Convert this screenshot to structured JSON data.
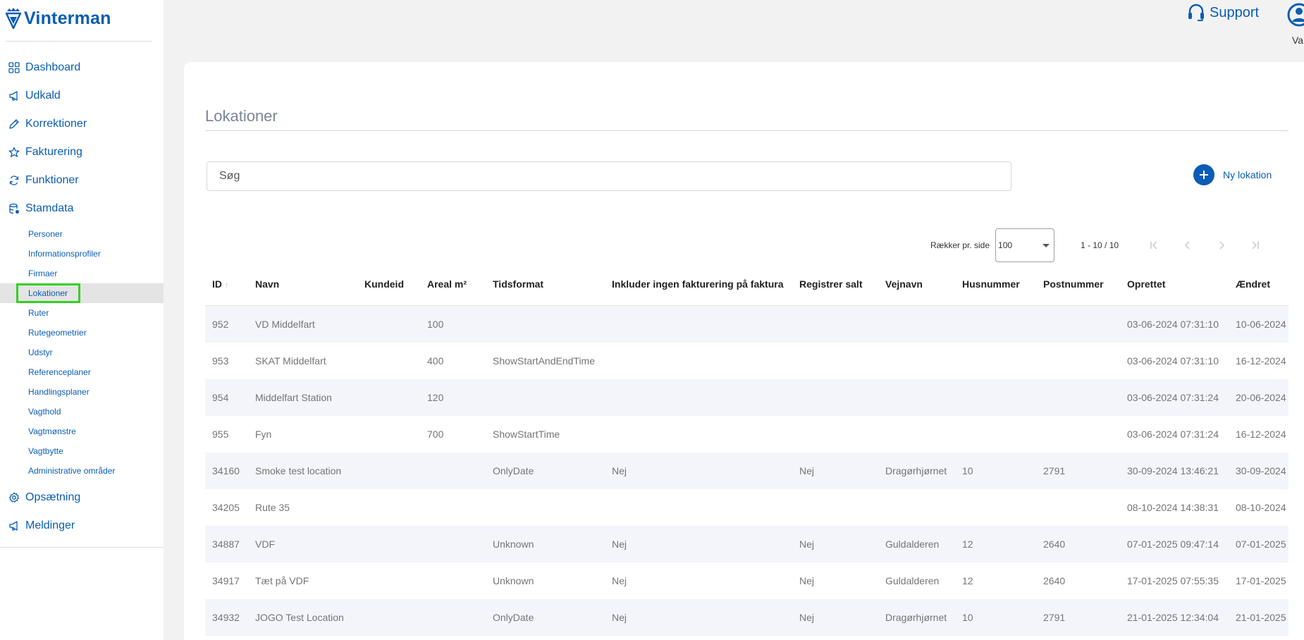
{
  "app": {
    "name": "Vinterman"
  },
  "sidebar": {
    "items": [
      {
        "label": "Dashboard",
        "icon": "grid-icon"
      },
      {
        "label": "Udkald",
        "icon": "megaphone-icon"
      },
      {
        "label": "Korrektioner",
        "icon": "pencil-icon"
      },
      {
        "label": "Fakturering",
        "icon": "star-icon"
      },
      {
        "label": "Funktioner",
        "icon": "refresh-icon"
      },
      {
        "label": "Stamdata",
        "icon": "database-icon"
      }
    ],
    "stamdata_sub": [
      "Personer",
      "Informationsprofiler",
      "Firmaer",
      "Lokationer",
      "Ruter",
      "Rutegeometrier",
      "Udstyr",
      "Referenceplaner",
      "Handlingsplaner",
      "Vagthold",
      "Vagtmønstre",
      "Vagtbytte",
      "Administrative områder"
    ],
    "active_sub": "Lokationer",
    "bottom_items": [
      {
        "label": "Opsætning",
        "icon": "gear-icon"
      },
      {
        "label": "Meldinger",
        "icon": "megaphone-icon"
      }
    ]
  },
  "topbar": {
    "support_label": "Support",
    "user_label": "Va"
  },
  "main": {
    "title": "Lokationer",
    "search_placeholder": "Søg",
    "new_location_label": "Ny lokation"
  },
  "pager": {
    "rows_label": "Rækker pr. side",
    "rows_value": "100",
    "range": "1 - 10 / 10"
  },
  "table": {
    "columns": [
      "ID",
      "Navn",
      "Kundeid",
      "Areal m²",
      "Tidsformat",
      "Inkluder ingen fakturering på faktura",
      "Registrer salt",
      "Vejnavn",
      "Husnummer",
      "Postnummer",
      "Oprettet",
      "Ændret"
    ],
    "rows": [
      [
        "952",
        "VD Middelfart",
        "",
        "100",
        "",
        "",
        "",
        "",
        "",
        "",
        "03-06-2024 07:31:10",
        "10-06-2024"
      ],
      [
        "953",
        "SKAT Middelfart",
        "",
        "400",
        "ShowStartAndEndTime",
        "",
        "",
        "",
        "",
        "",
        "03-06-2024 07:31:10",
        "16-12-2024"
      ],
      [
        "954",
        "Middelfart Station",
        "",
        "120",
        "",
        "",
        "",
        "",
        "",
        "",
        "03-06-2024 07:31:24",
        "20-06-2024"
      ],
      [
        "955",
        "Fyn",
        "",
        "700",
        "ShowStartTime",
        "",
        "",
        "",
        "",
        "",
        "03-06-2024 07:31:24",
        "16-12-2024"
      ],
      [
        "34160",
        "Smoke test location",
        "",
        "",
        "OnlyDate",
        "Nej",
        "Nej",
        "Dragørhjørnet",
        "10",
        "2791",
        "30-09-2024 13:46:21",
        "30-09-2024"
      ],
      [
        "34205",
        "Rute 35",
        "",
        "",
        "",
        "",
        "",
        "",
        "",
        "",
        "08-10-2024 14:38:31",
        "08-10-2024"
      ],
      [
        "34887",
        "VDF",
        "",
        "",
        "Unknown",
        "Nej",
        "Nej",
        "Guldalderen",
        "12",
        "2640",
        "07-01-2025 09:47:14",
        "07-01-2025"
      ],
      [
        "34917",
        "Tæt på VDF",
        "",
        "",
        "Unknown",
        "Nej",
        "Nej",
        "Guldalderen",
        "12",
        "2640",
        "17-01-2025 07:55:35",
        "17-01-2025"
      ],
      [
        "34932",
        "JOGO Test Location",
        "",
        "",
        "OnlyDate",
        "Nej",
        "Nej",
        "Dragørhjørnet",
        "10",
        "2791",
        "21-01-2025 12:34:04",
        "21-01-2025"
      ]
    ]
  },
  "colors": {
    "accent": "#0a5db4",
    "highlight": "#35d024",
    "row_alt": "#f3f5fb"
  }
}
